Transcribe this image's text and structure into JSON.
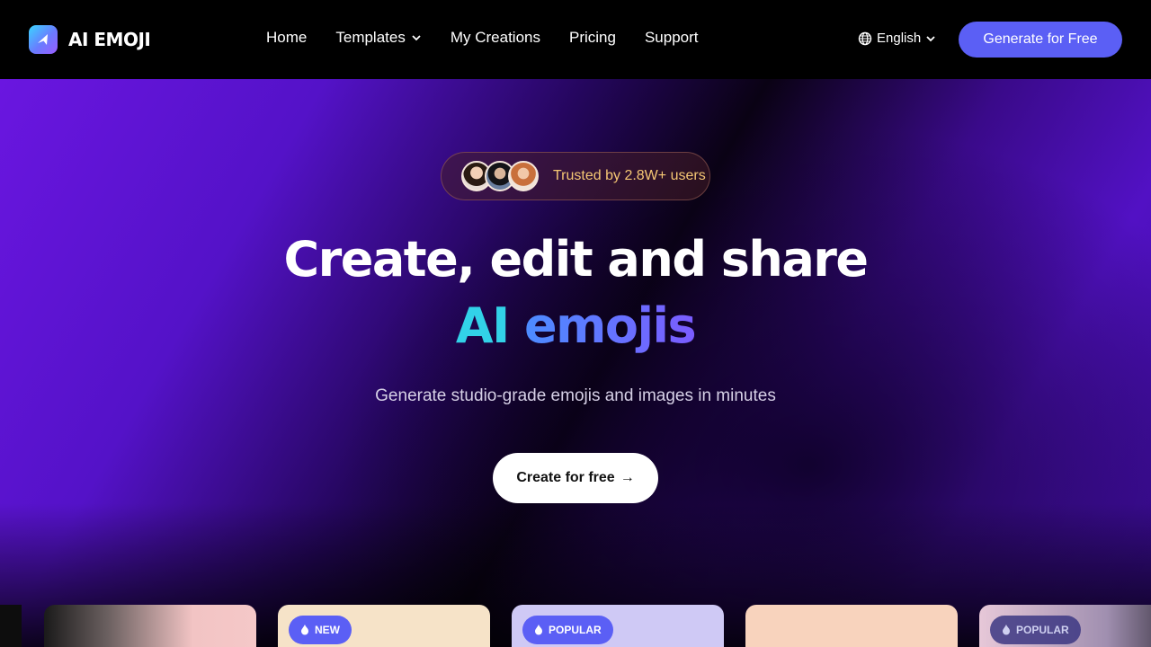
{
  "brand": {
    "name": "AI EMOJI",
    "logo_icon": "arrow-logo-icon"
  },
  "nav": {
    "links": [
      {
        "label": "Home"
      },
      {
        "label": "Templates",
        "has_dropdown": true
      },
      {
        "label": "My Creations"
      },
      {
        "label": "Pricing"
      },
      {
        "label": "Support"
      }
    ],
    "language": "English",
    "cta": "Generate for Free"
  },
  "hero": {
    "trusted": "Trusted by 2.8W+ users",
    "title_line1": "Create, edit and share",
    "title_ai": "AI",
    "title_emojis": "emojis",
    "subtitle": "Generate studio-grade emojis and images in minutes",
    "cta": "Create for free",
    "cta_arrow": "→"
  },
  "cards": [
    {
      "badge": ""
    },
    {
      "badge": "NEW"
    },
    {
      "badge": "POPULAR"
    },
    {
      "badge": ""
    },
    {
      "badge": "POPULAR"
    }
  ],
  "colors": {
    "accent": "#5b5ff5",
    "trusted_text": "#f6c774",
    "gradient_ai": "#32d2e8",
    "gradient_emojis": "#6f6cff"
  }
}
